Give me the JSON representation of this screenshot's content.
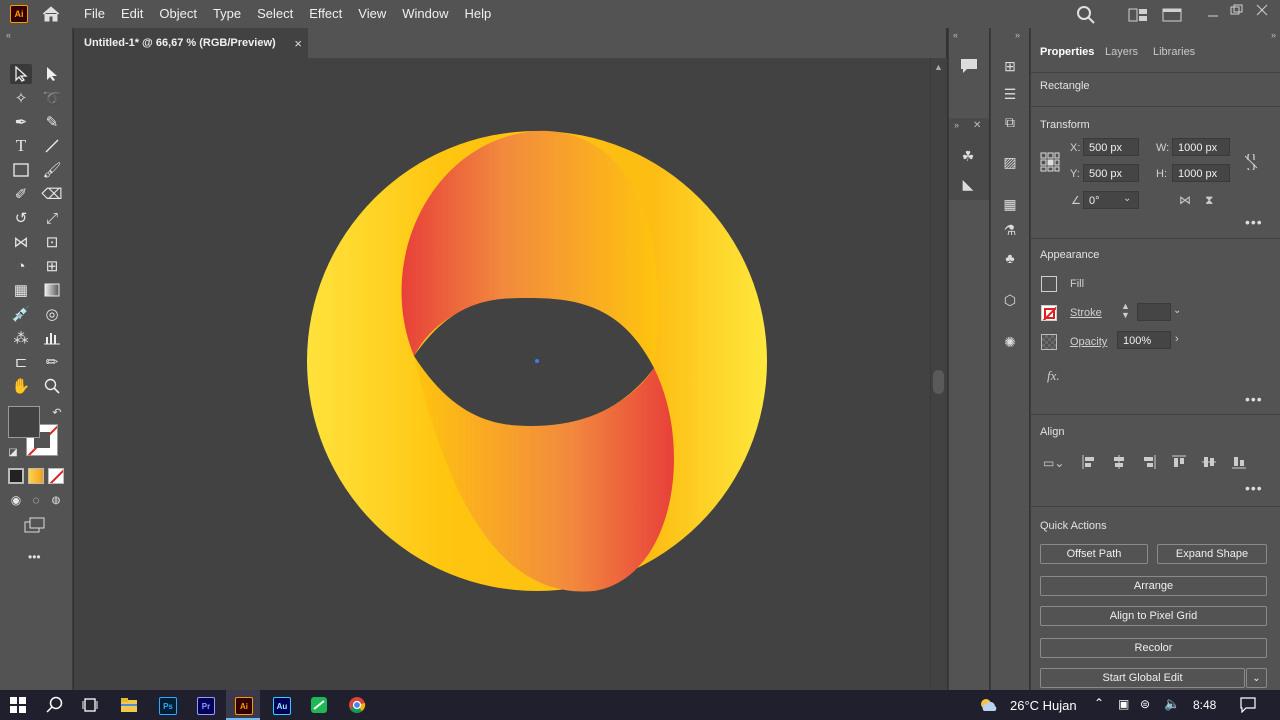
{
  "app": {
    "logo": "Ai"
  },
  "menu": [
    "File",
    "Edit",
    "Object",
    "Type",
    "Select",
    "Effect",
    "View",
    "Window",
    "Help"
  ],
  "document": {
    "tab_title": "Untitled-1* @ 66,67 % (RGB/Preview)",
    "close": "×"
  },
  "panel": {
    "tabs": [
      "Properties",
      "Layers",
      "Libraries"
    ],
    "object_type": "Rectangle",
    "transform": {
      "title": "Transform",
      "x_label": "X:",
      "x_value": "500 px",
      "y_label": "Y:",
      "y_value": "500 px",
      "w_label": "W:",
      "w_value": "1000 px",
      "h_label": "H:",
      "h_value": "1000 px",
      "angle_value": "0°"
    },
    "appearance": {
      "title": "Appearance",
      "fill_label": "Fill",
      "stroke_label": "Stroke",
      "opacity_label": "Opacity",
      "opacity_value": "100%",
      "fx_label": "fx."
    },
    "align": {
      "title": "Align"
    },
    "quick_actions": {
      "title": "Quick Actions",
      "offset_path": "Offset Path",
      "expand_shape": "Expand Shape",
      "arrange": "Arrange",
      "align_pixel": "Align to Pixel Grid",
      "recolor": "Recolor",
      "global_edit": "Start Global Edit"
    },
    "more": "•••"
  },
  "toolbar": {
    "more": "•••"
  },
  "taskbar": {
    "apps": [
      "Ps",
      "Pr",
      "Ai",
      "Au"
    ],
    "weather": "26°C  Hujan",
    "time": "8:48"
  },
  "colors": {
    "accent_orange": "#ff9a00",
    "gradient_yellow": "#ffc107",
    "gradient_red": "#e8403a"
  }
}
